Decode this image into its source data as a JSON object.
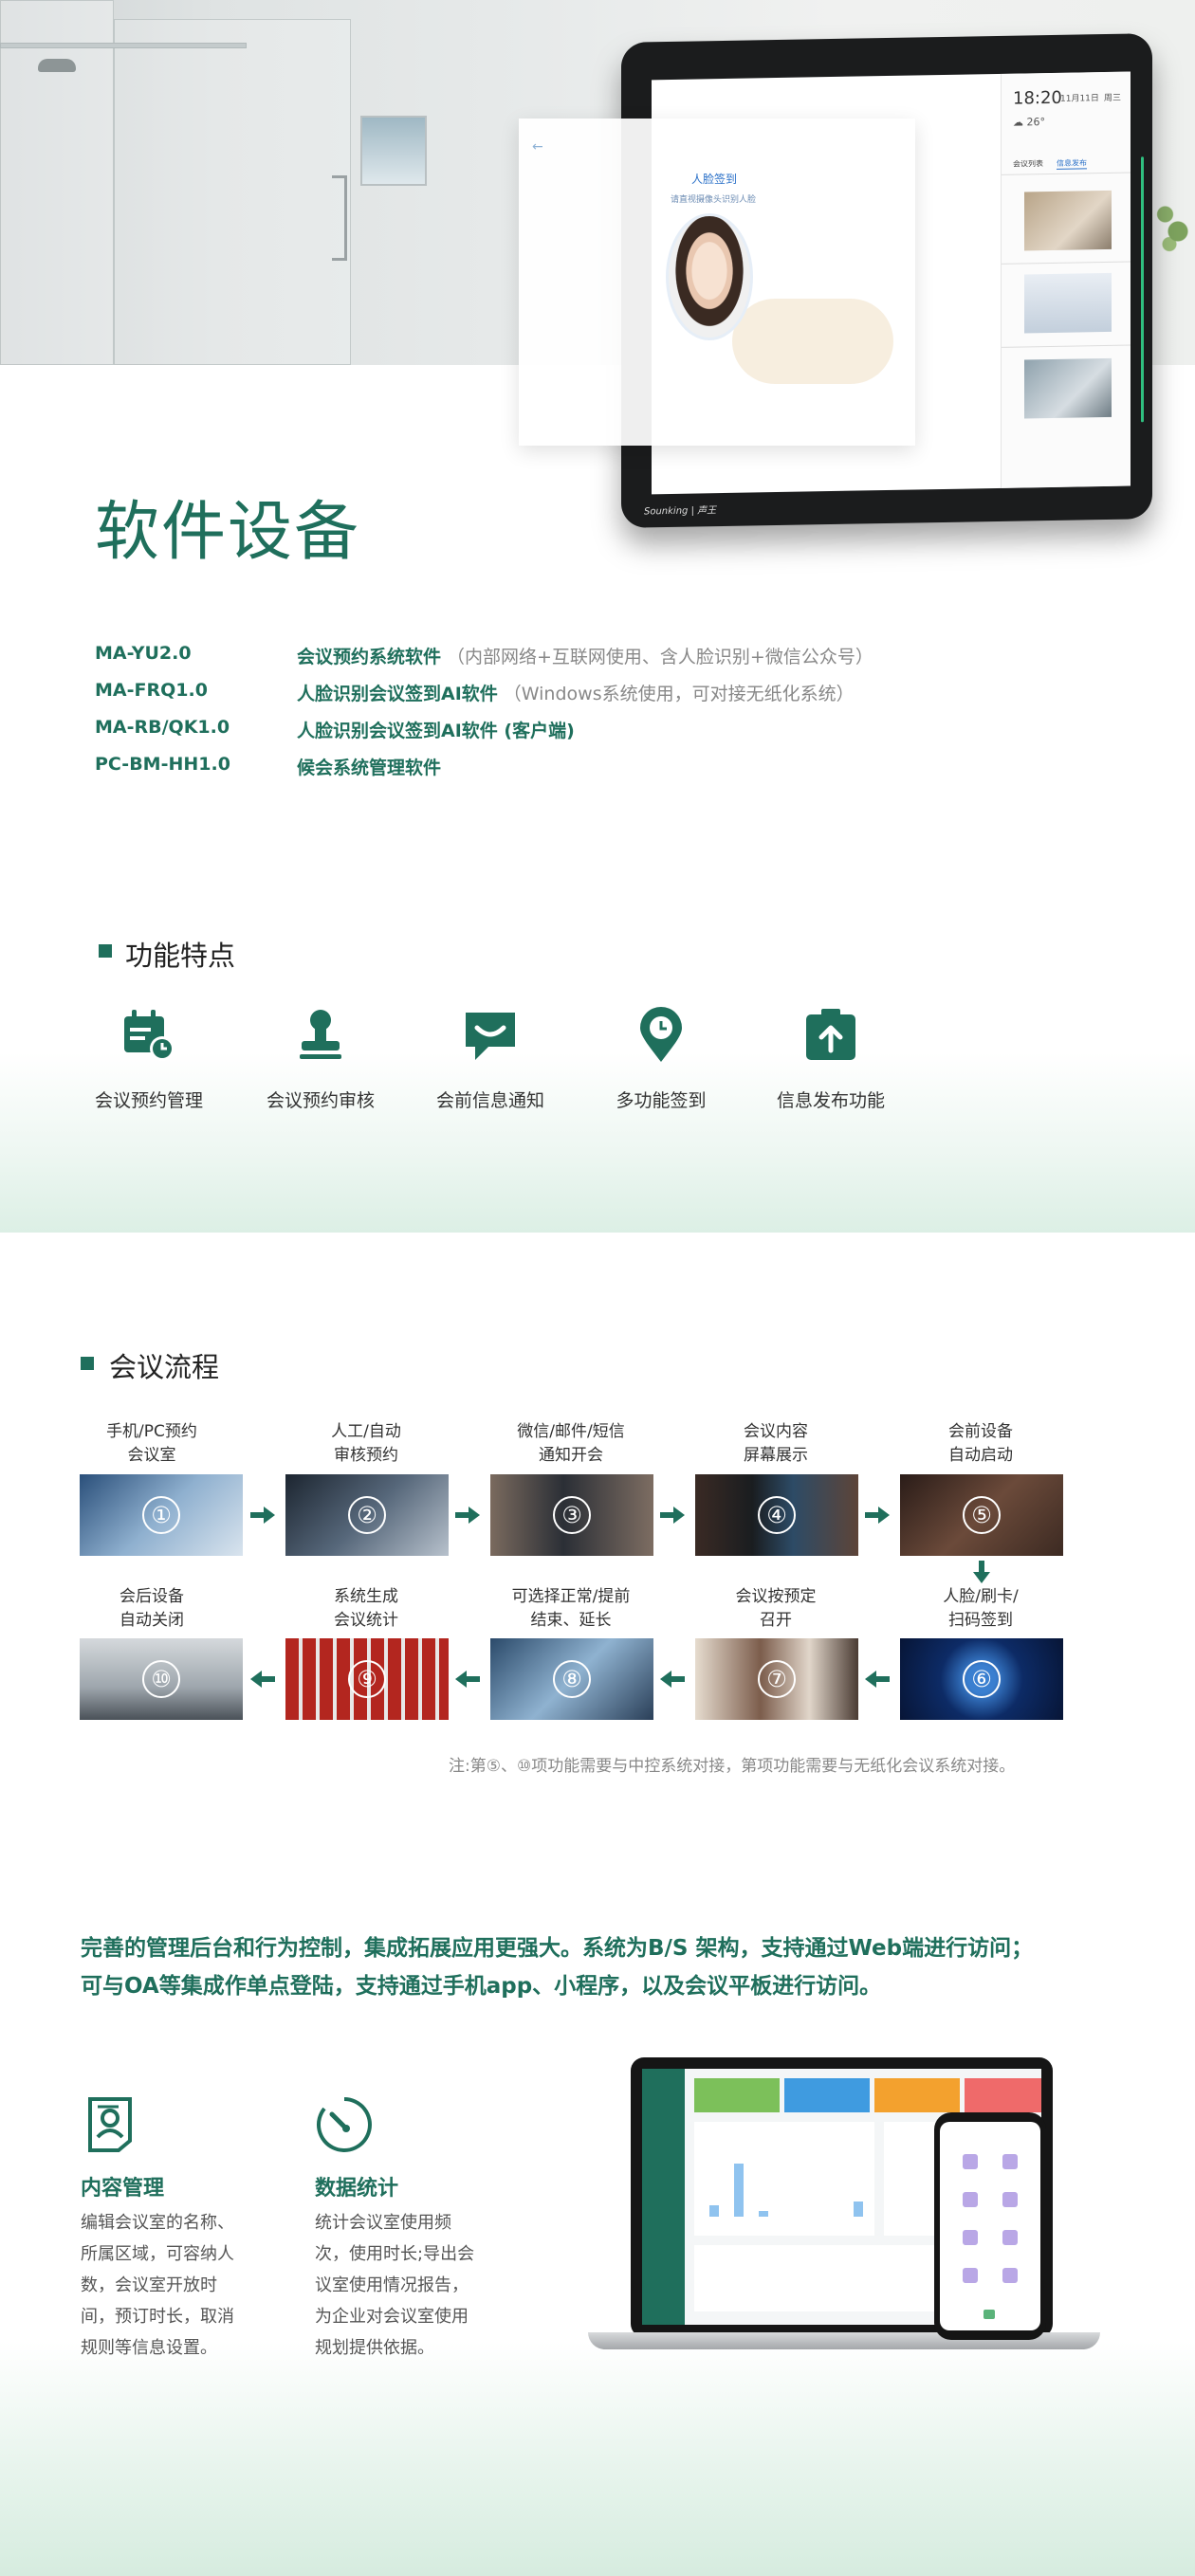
{
  "hero": {
    "tablet": {
      "time": "18:20",
      "date": "11月11日",
      "weekday": "周三",
      "temperature": "26°",
      "tab_1": "会议列表",
      "tab_2": "信息发布",
      "brand": "Sounking | 声王",
      "popup_back": "←",
      "popup_title": "人脸签到",
      "popup_subtitle": "请直视摄像头识别人脸"
    },
    "title": "软件设备"
  },
  "specs": [
    {
      "code": "MA-YU2.0",
      "name": "会议预约系统软件",
      "note": "（内部网络+互联网使用、含人脸识别+微信公众号）"
    },
    {
      "code": "MA-FRQ1.0",
      "name": "人脸识别会议签到AI软件",
      "note": "（Windows系统使用，可对接无纸化系统）"
    },
    {
      "code": "MA-RB/QK1.0",
      "name": "人脸识别会议签到AI软件 (客户端)",
      "note": ""
    },
    {
      "code": "PC-BM-HH1.0",
      "name": "候会系统管理软件",
      "note": ""
    }
  ],
  "features": {
    "title": "功能特点",
    "items": [
      {
        "label": "会议预约管理",
        "icon": "calendar-clock-icon"
      },
      {
        "label": "会议预约审核",
        "icon": "stamp-icon"
      },
      {
        "label": "会前信息通知",
        "icon": "chat-bubble-icon"
      },
      {
        "label": "多功能签到",
        "icon": "location-pin-icon"
      },
      {
        "label": "信息发布功能",
        "icon": "upload-box-icon"
      }
    ]
  },
  "flow": {
    "title": "会议流程",
    "steps": [
      {
        "num": "①",
        "line1": "手机/PC预约",
        "line2": "会议室"
      },
      {
        "num": "②",
        "line1": "人工/自动",
        "line2": "审核预约"
      },
      {
        "num": "③",
        "line1": "微信/邮件/短信",
        "line2": "通知开会"
      },
      {
        "num": "④",
        "line1": "会议内容",
        "line2": "屏幕展示"
      },
      {
        "num": "⑤",
        "line1": "会前设备",
        "line2": "自动启动"
      },
      {
        "num": "⑥",
        "line1": "人脸/刷卡/",
        "line2": "扫码签到"
      },
      {
        "num": "⑦",
        "line1": "会议按预定",
        "line2": "召开"
      },
      {
        "num": "⑧",
        "line1": "可选择正常/提前",
        "line2": "结束、延长"
      },
      {
        "num": "⑨",
        "line1": "系统生成",
        "line2": "会议统计"
      },
      {
        "num": "⑩",
        "line1": "会后设备",
        "line2": "自动关闭"
      }
    ],
    "note": "注:第⑤、⑩项功能需要与中控系统对接，第项功能需要与无纸化会议系统对接。"
  },
  "statement": {
    "line1": "完善的管理后台和行为控制，集成拓展应用更强大。系统为B/S 架构，支持通过Web端进行访问；",
    "line2": "可与OA等集成作单点登陆，支持通过手机app、小程序，以及会议平板进行访问。"
  },
  "management": [
    {
      "icon": "document-user-icon",
      "title": "内容管理",
      "desc": [
        "编辑会议室的名称、",
        "所属区域，可容纳人",
        "数，会议室开放时",
        "间，预订时长，取消",
        "规则等信息设置。"
      ]
    },
    {
      "icon": "gauge-icon",
      "title": "数据统计",
      "desc": [
        "统计会议室使用频",
        "次，使用时长;导出会",
        "议室使用情况报告，",
        "为企业对会议室使用",
        "规划提供依据。"
      ]
    }
  ],
  "colors": {
    "brand": "#1f6f5c",
    "text": "#333333",
    "muted": "#888888",
    "band": "#dcefe5"
  }
}
